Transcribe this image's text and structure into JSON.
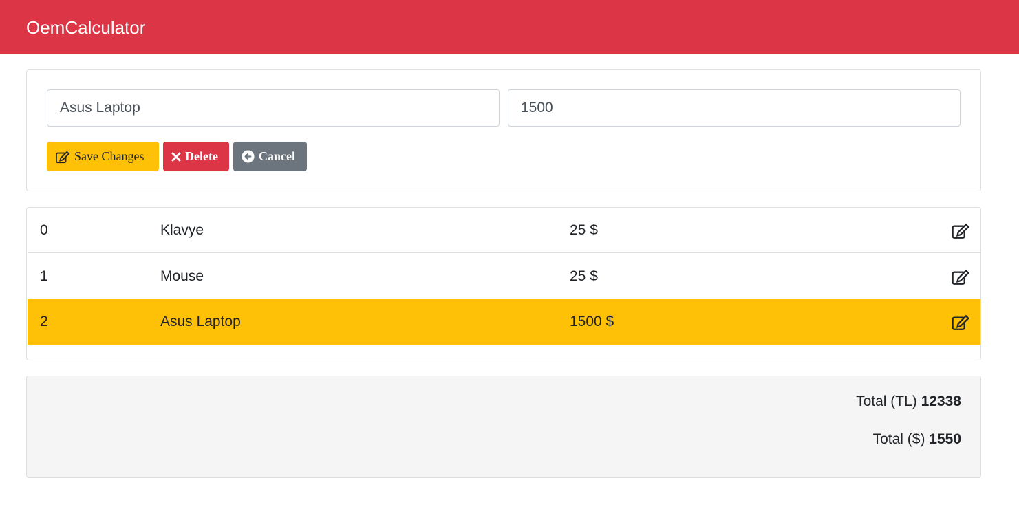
{
  "app": {
    "title": "OemCalculator"
  },
  "editor": {
    "name_value": "Asus Laptop",
    "price_value": "1500",
    "save_label": "Save Changes",
    "delete_label": "Delete",
    "cancel_label": "Cancel"
  },
  "items": [
    {
      "index": "0",
      "name": "Klavye",
      "price": "25 $",
      "selected": false
    },
    {
      "index": "1",
      "name": "Mouse",
      "price": "25 $",
      "selected": false
    },
    {
      "index": "2",
      "name": "Asus Laptop",
      "price": "1500 $",
      "selected": true
    }
  ],
  "totals": {
    "tl_label": "Total (TL)",
    "tl_value": "12338",
    "usd_label": "Total ($)",
    "usd_value": "1550"
  },
  "colors": {
    "navbar": "#dc3545",
    "selected_row": "#ffc107",
    "save_button": "#ffc107",
    "delete_button": "#dc3545",
    "cancel_button": "#6c757d"
  },
  "icons": {
    "save": "edit-icon",
    "delete": "times-icon",
    "cancel": "arrow-circle-left-icon",
    "row_edit": "edit-icon"
  }
}
